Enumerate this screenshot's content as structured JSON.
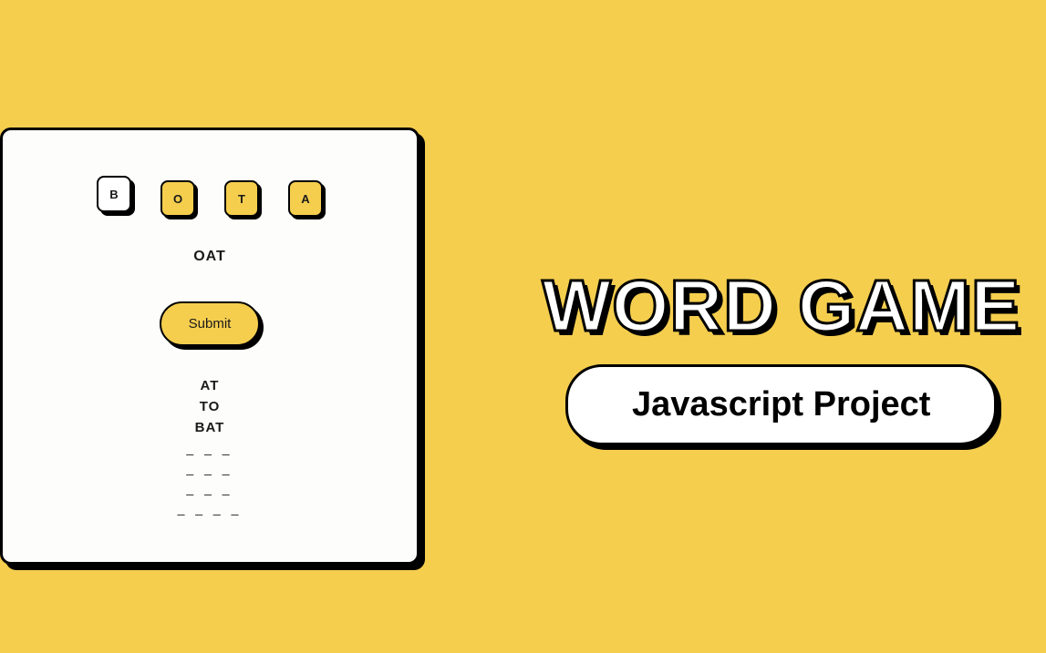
{
  "tiles": {
    "selected": "B",
    "available": [
      "O",
      "T",
      "A"
    ]
  },
  "current_word": "OAT",
  "submit_label": "Submit",
  "found_words": [
    "AT",
    "TO",
    "BAT"
  ],
  "blank_slots": [
    "_ _ _",
    "_ _ _",
    "_ _ _",
    "_ _ _ _"
  ],
  "title": "WORD GAME",
  "subtitle": "Javascript Project"
}
